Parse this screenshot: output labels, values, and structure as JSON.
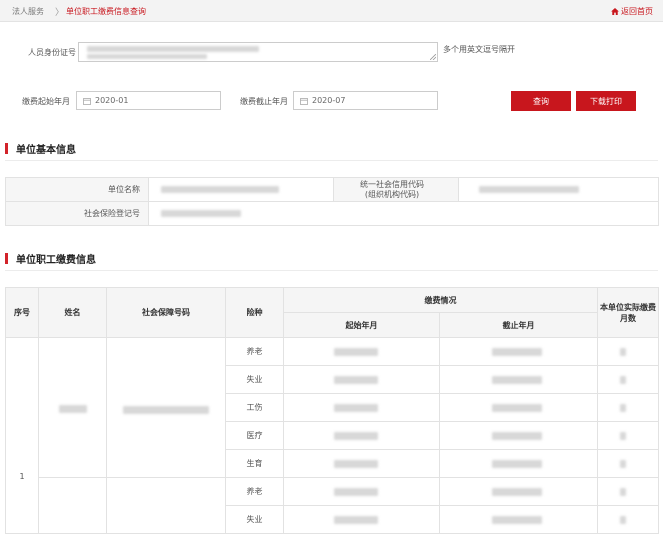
{
  "breadcrumb": {
    "root": "法人服务",
    "separator": "〉",
    "current": "单位职工缴费信息查询"
  },
  "home_link": "返回首页",
  "query": {
    "id_label": "人员身份证号",
    "id_hint": "多个用英文逗号隔开",
    "start_label": "缴费起始年月",
    "start_value": "2020-01",
    "end_label": "缴费截止年月",
    "end_value": "2020-07",
    "query_button": "查询",
    "print_button": "下载打印"
  },
  "unit_info": {
    "title": "单位基本信息",
    "name_label": "单位名称",
    "credit_code_label_line1": "统一社会信用代码",
    "credit_code_label_line2": "(组织机构代码)",
    "social_reg_label": "社会保险登记号"
  },
  "employee_info": {
    "title": "单位职工缴费信息",
    "headers": {
      "seq": "序号",
      "name": "姓名",
      "ss_no": "社会保障号码",
      "insurance": "险种",
      "payment_group": "缴费情况",
      "start_month": "起始年月",
      "end_month": "截止年月",
      "actual_months_line1": "本单位实际缴费",
      "actual_months_line2": "月数"
    },
    "row_seq": "1",
    "insurance_types": [
      "养老",
      "失业",
      "工伤",
      "医疗",
      "生育",
      "养老",
      "失业"
    ]
  },
  "colors": {
    "brand_red": "#c8161d",
    "header_bg": "#f5f5f5"
  }
}
